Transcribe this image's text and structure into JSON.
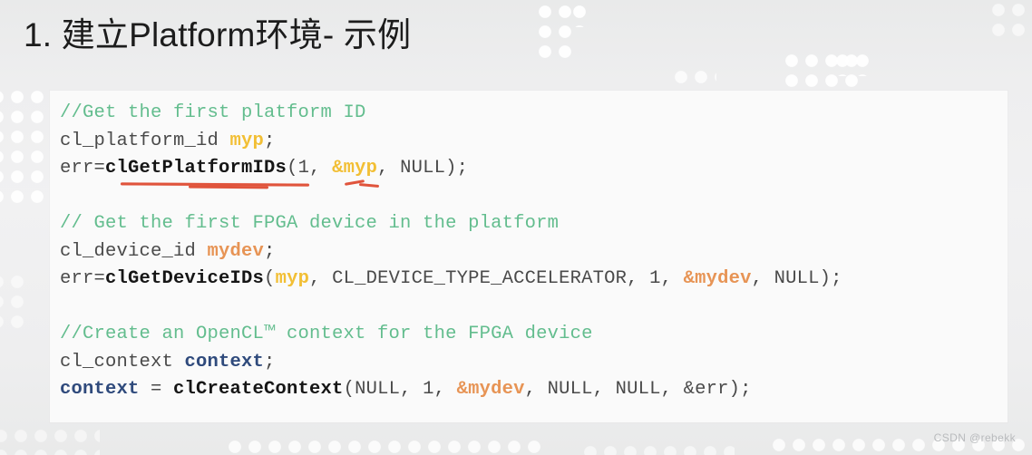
{
  "slide": {
    "title": "1. 建立Platform环境- 示例",
    "watermark": "CSDN @rebekk",
    "colors": {
      "background": "#eeeeef",
      "panel": "#fafafa",
      "comment_green": "#63bd8e",
      "plain_text": "#4a4a4a",
      "api_bold": "#161616",
      "var_myp_amber": "#f2bf35",
      "var_mydev_orange": "#e79455",
      "var_context_navy": "#2f4a7c",
      "annotation_red": "#e0543c",
      "title_text": "#1c1c1c",
      "watermark_text": "#b9bbbd"
    }
  },
  "code": {
    "language": "C / OpenCL",
    "lines": [
      {
        "id": "l1",
        "tokens": [
          {
            "t": "//Get the first platform ID",
            "c": "cm"
          }
        ]
      },
      {
        "id": "l2",
        "tokens": [
          {
            "t": "cl_platform_id ",
            "c": "pl"
          },
          {
            "t": "myp",
            "c": "myp"
          },
          {
            "t": ";",
            "c": "pl"
          }
        ]
      },
      {
        "id": "l3",
        "tokens": [
          {
            "t": "err=",
            "c": "pl"
          },
          {
            "t": "clGetPlatformIDs",
            "c": "fn"
          },
          {
            "t": "(1, ",
            "c": "pl"
          },
          {
            "t": "&myp",
            "c": "myp"
          },
          {
            "t": ", NULL);",
            "c": "pl"
          }
        ]
      },
      {
        "id": "l4",
        "tokens": []
      },
      {
        "id": "l5",
        "tokens": [
          {
            "t": "// Get the first FPGA device in the platform",
            "c": "cm"
          }
        ]
      },
      {
        "id": "l6",
        "tokens": [
          {
            "t": "cl_device_id ",
            "c": "pl"
          },
          {
            "t": "mydev",
            "c": "mydev"
          },
          {
            "t": ";",
            "c": "pl"
          }
        ]
      },
      {
        "id": "l7",
        "tokens": [
          {
            "t": "err=",
            "c": "pl"
          },
          {
            "t": "clGetDeviceIDs",
            "c": "fn"
          },
          {
            "t": "(",
            "c": "pl"
          },
          {
            "t": "myp",
            "c": "myp"
          },
          {
            "t": ", CL_DEVICE_TYPE_ACCELERATOR, 1, ",
            "c": "pl"
          },
          {
            "t": "&mydev",
            "c": "mydev"
          },
          {
            "t": ", NULL);",
            "c": "pl"
          }
        ]
      },
      {
        "id": "l8",
        "tokens": []
      },
      {
        "id": "l9",
        "tokens": [
          {
            "t": "//Create an OpenCL™ context for the FPGA device",
            "c": "cm"
          }
        ]
      },
      {
        "id": "l10",
        "tokens": [
          {
            "t": "cl_context ",
            "c": "pl"
          },
          {
            "t": "context",
            "c": "ctx"
          },
          {
            "t": ";",
            "c": "pl"
          }
        ]
      },
      {
        "id": "l11",
        "tokens": [
          {
            "t": "context",
            "c": "ctx"
          },
          {
            "t": " = ",
            "c": "pl"
          },
          {
            "t": "clCreateContext",
            "c": "fn"
          },
          {
            "t": "(NULL, 1, ",
            "c": "pl"
          },
          {
            "t": "&mydev",
            "c": "mydev"
          },
          {
            "t": ", NULL, NULL, &err);",
            "c": "pl"
          }
        ]
      }
    ]
  },
  "annotations": {
    "underline_target": "clGetPlatformIDs",
    "underline_tick_target": "1,"
  }
}
